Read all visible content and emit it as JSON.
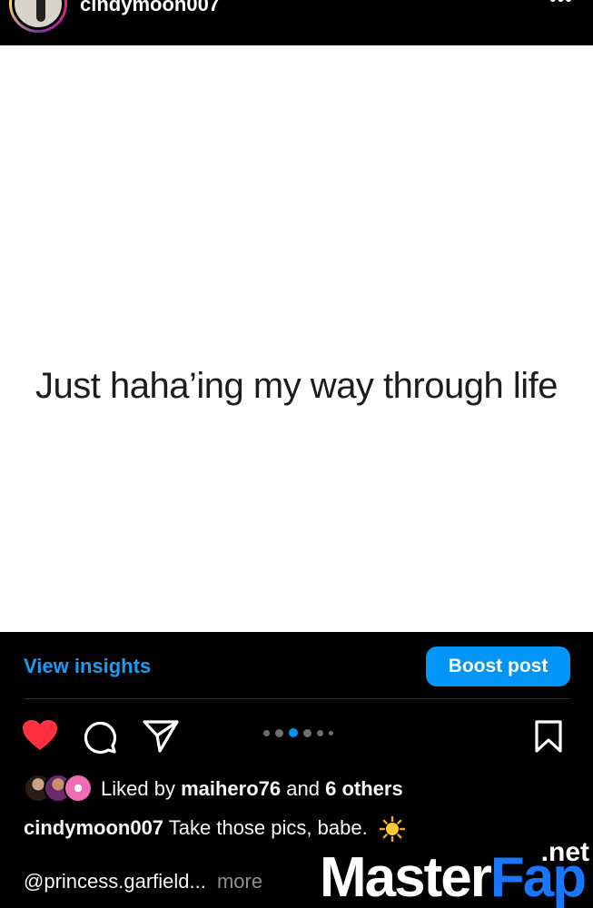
{
  "header": {
    "username": "cindymoon007",
    "more_icon": "ellipsis-horizontal-icon",
    "more_label": "•••"
  },
  "post": {
    "image_text": "Just haha’ing my way through life",
    "carousel": {
      "count": 6,
      "active_index": 2
    }
  },
  "insights": {
    "view_insights_label": "View insights",
    "boost_label": "Boost post",
    "accent_color": "#0095f6"
  },
  "actions": {
    "like_icon": "heart-filled-icon",
    "like_color": "#ff3040",
    "comment_icon": "comment-icon",
    "share_icon": "paper-plane-icon",
    "save_icon": "bookmark-icon"
  },
  "likes": {
    "prefix": "Liked by",
    "user": "maihero76",
    "joiner": "and",
    "others": "6 others"
  },
  "caption": {
    "username": "cindymoon007",
    "text": "Take those pics, babe.",
    "emoji_icon": "sun-icon"
  },
  "comments": {
    "mention": "@princess.garfield...",
    "more_label": "more"
  },
  "watermark": {
    "net": ".net",
    "master": "Master",
    "fap": "Fap"
  }
}
